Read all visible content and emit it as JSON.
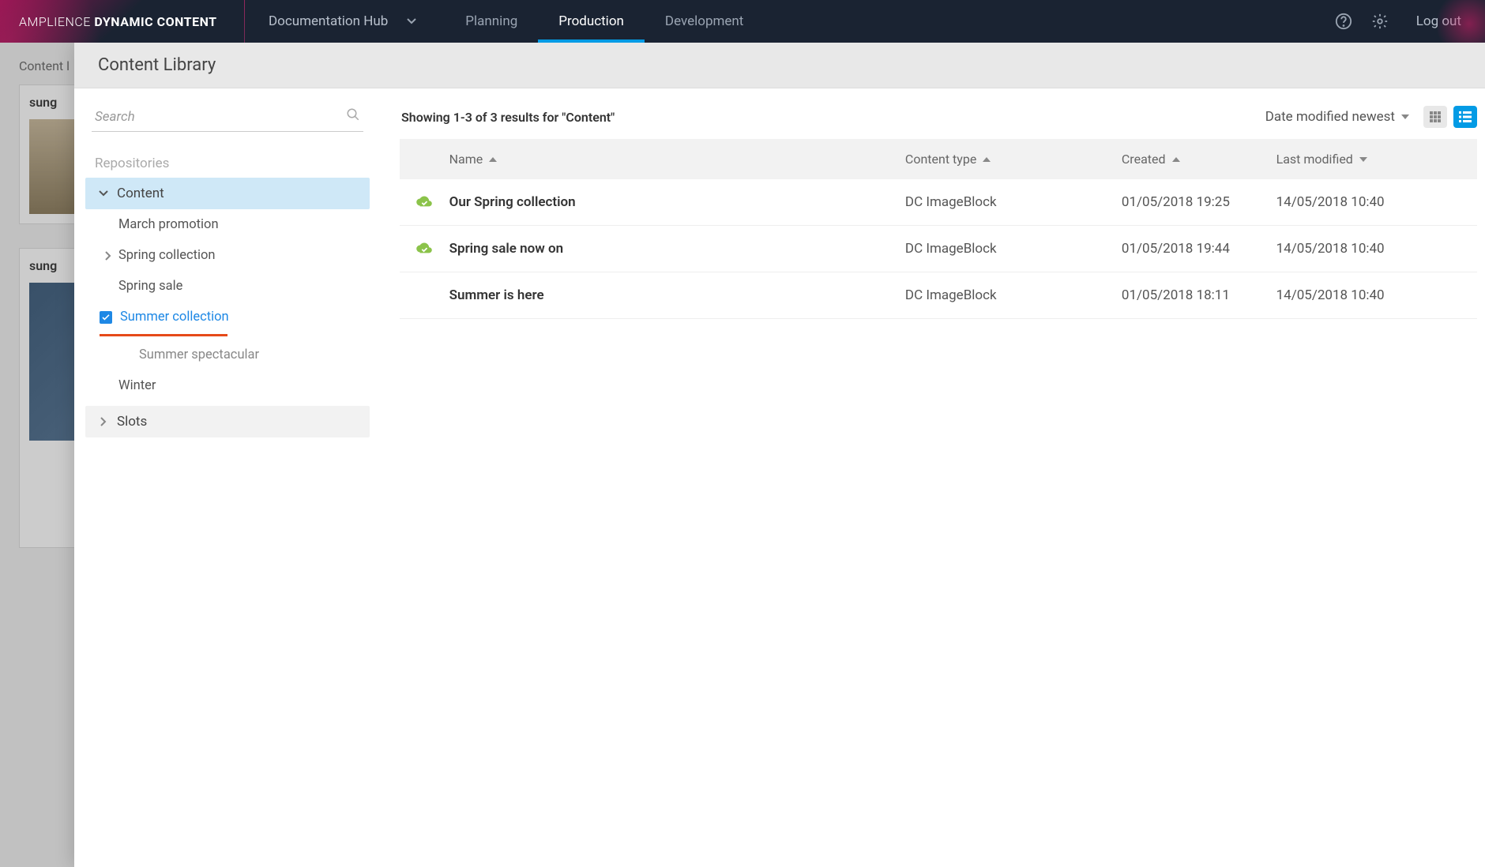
{
  "brand": {
    "light": "AMPLIENCE",
    "bold": "DYNAMIC CONTENT"
  },
  "hub": {
    "label": "Documentation Hub"
  },
  "nav": {
    "planning": "Planning",
    "production": "Production",
    "development": "Development"
  },
  "topbar": {
    "logout": "Log out"
  },
  "background": {
    "breadcrumb": "Content l",
    "card1_title": "sung",
    "card2_title": "sung"
  },
  "library": {
    "title": "Content Library"
  },
  "search": {
    "placeholder": "Search"
  },
  "sidebar": {
    "repos_label": "Repositories",
    "content": "Content",
    "items": {
      "march": "March promotion",
      "spring_collection": "Spring collection",
      "spring_sale": "Spring sale",
      "summer_collection": "Summer collection",
      "summer_spectacular": "Summer spectacular",
      "winter": "Winter"
    },
    "slots": "Slots"
  },
  "results": {
    "text": "Showing 1-3 of 3 results for \"Content\"",
    "sort_label": "Date modified newest"
  },
  "columns": {
    "name": "Name",
    "type": "Content type",
    "created": "Created",
    "modified": "Last modified"
  },
  "rows": [
    {
      "name": "Our Spring collection",
      "type": "DC ImageBlock",
      "created": "01/05/2018 19:25",
      "modified": "14/05/2018 10:40",
      "published": true
    },
    {
      "name": "Spring sale now on",
      "type": "DC ImageBlock",
      "created": "01/05/2018 19:44",
      "modified": "14/05/2018 10:40",
      "published": true
    },
    {
      "name": "Summer is here",
      "type": "DC ImageBlock",
      "created": "01/05/2018 18:11",
      "modified": "14/05/2018 10:40",
      "published": false
    }
  ]
}
